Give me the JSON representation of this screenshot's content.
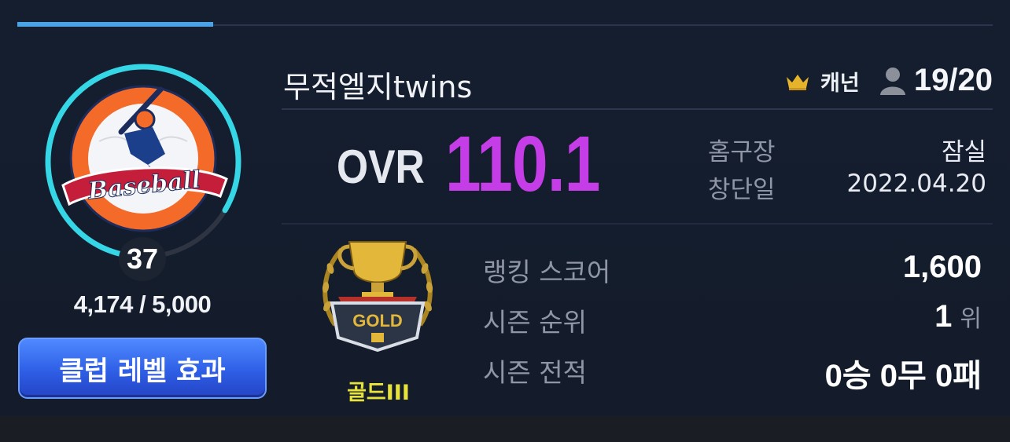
{
  "club": {
    "name": "무적엘지twins",
    "role": "캐넌",
    "member_count": "19/20"
  },
  "level": {
    "value": "37",
    "exp_text": "4,174 / 5,000",
    "progress": 0.835,
    "button_label": "클럽 레벨 효과",
    "emblem_text": "Baseball"
  },
  "ovr": {
    "label": "OVR",
    "value": "110.1"
  },
  "info": {
    "stadium_label": "홈구장",
    "stadium_value": "잠실",
    "founded_label": "창단일",
    "founded_value": "2022.04.20"
  },
  "tier": {
    "name": "골드III",
    "badge_text": "GOLD"
  },
  "stats": {
    "ranking_score_label": "랭킹 스코어",
    "ranking_score_value": "1,600",
    "season_rank_label": "시즌 순위",
    "season_rank_value": "1",
    "season_rank_unit": "위",
    "season_record_label": "시즌 전적",
    "season_record_value": "0승 0무 0패"
  },
  "colors": {
    "accent_tab": "#49a3e6",
    "ovr": "#c43de6",
    "ring": "#35d7e6",
    "tier": "#e8e33a",
    "button": "#2e5fe6"
  },
  "icons": [
    "crown-icon",
    "member-icon",
    "club-emblem",
    "gold-trophy-icon"
  ]
}
